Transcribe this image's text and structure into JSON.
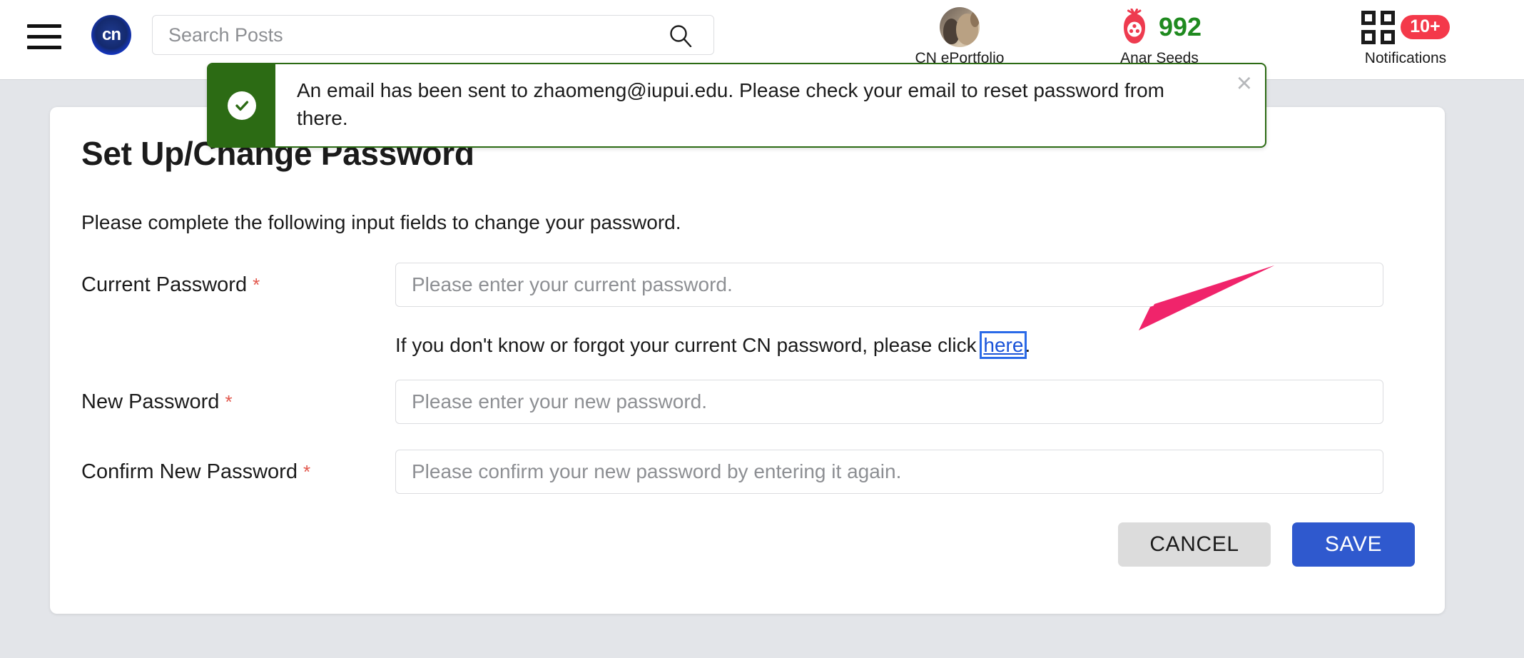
{
  "header": {
    "menu_icon": "hamburger-menu-icon",
    "logo_text": "cn",
    "search": {
      "placeholder": "Search Posts",
      "value": "",
      "icon": "search-icon"
    },
    "portfolio": {
      "label": "CN ePortfolio",
      "icon": "avatar"
    },
    "seeds": {
      "label": "Anar Seeds",
      "count": "992",
      "icon": "pomegranate-icon",
      "count_color": "#1f8a1f",
      "icon_color": "#ee3b4f"
    },
    "notifications": {
      "label": "Notifications",
      "badge": "10+",
      "icon": "grid-apps-icon",
      "badge_color": "#f4394a"
    }
  },
  "alert": {
    "type": "success",
    "icon": "check-circle-icon",
    "message": "An email has been sent to zhaomeng@iupui.edu. Please check your email to reset password from there.",
    "close_label": "×",
    "accent_color": "#2c6b14"
  },
  "card": {
    "title": "Set Up/Change Password",
    "intro": "Please complete the following input fields to change your password.",
    "required_marker": "*",
    "fields": [
      {
        "label": "Current Password",
        "required": true,
        "placeholder": "Please enter your current password.",
        "value": ""
      },
      {
        "label": "New Password",
        "required": true,
        "placeholder": "Please enter your new password.",
        "value": ""
      },
      {
        "label": "Confirm New Password",
        "required": true,
        "placeholder": "Please confirm your new password by entering it again.",
        "value": ""
      }
    ],
    "hint": {
      "before": "If you don't know or forgot your current CN password, please click ",
      "link": "here",
      "after": ".",
      "link_color": "#1a53d8"
    },
    "buttons": {
      "cancel": "CANCEL",
      "save": "SAVE",
      "save_color": "#2f59ce",
      "cancel_color": "#dcdcdc"
    }
  },
  "annotation": {
    "arrow_color": "#f0246b",
    "points_to": "here-link"
  }
}
